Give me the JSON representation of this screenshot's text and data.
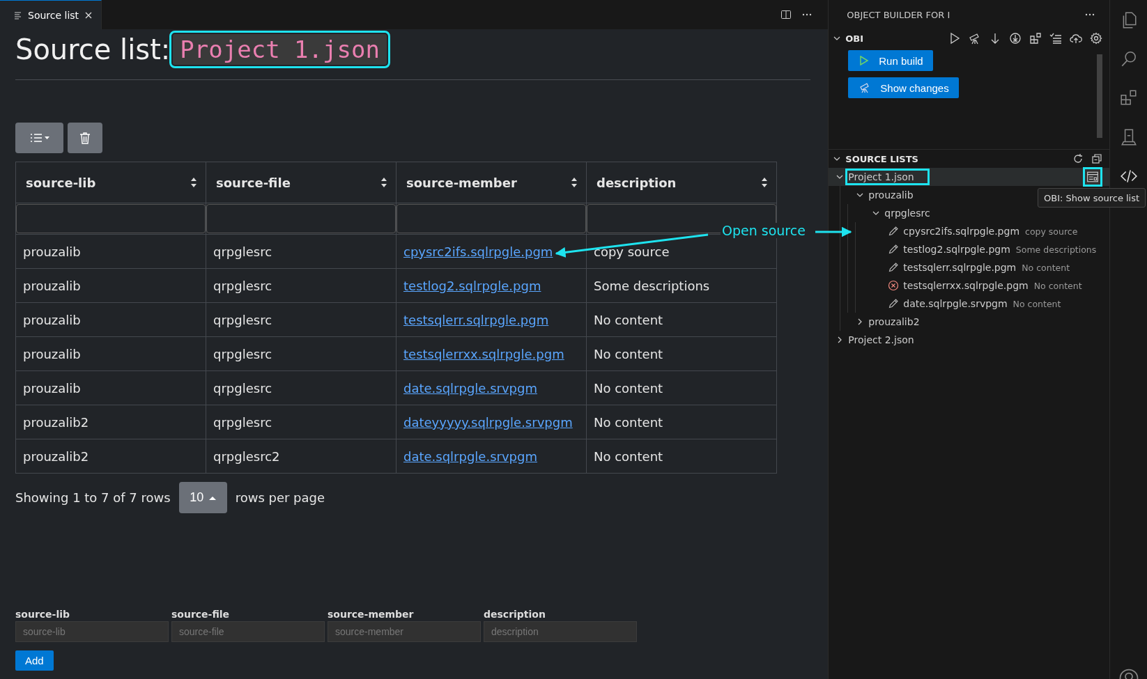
{
  "tab": {
    "label": "Source list",
    "selected": true
  },
  "title": {
    "prefix": "Source list:",
    "name": "Project 1.json"
  },
  "table": {
    "columns": [
      {
        "label": "source-lib"
      },
      {
        "label": "source-file"
      },
      {
        "label": "source-member"
      },
      {
        "label": "description"
      }
    ],
    "rows": [
      {
        "source_lib": "prouzalib",
        "source_file": "qrpglesrc",
        "source_member": "cpysrc2ifs.sqlrpgle.pgm",
        "description": "copy source"
      },
      {
        "source_lib": "prouzalib",
        "source_file": "qrpglesrc",
        "source_member": "testlog2.sqlrpgle.pgm",
        "description": "Some descriptions"
      },
      {
        "source_lib": "prouzalib",
        "source_file": "qrpglesrc",
        "source_member": "testsqlerr.sqlrpgle.pgm",
        "description": "No content"
      },
      {
        "source_lib": "prouzalib",
        "source_file": "qrpglesrc",
        "source_member": "testsqlerrxx.sqlrpgle.pgm",
        "description": "No content"
      },
      {
        "source_lib": "prouzalib",
        "source_file": "qrpglesrc",
        "source_member": "date.sqlrpgle.srvpgm",
        "description": "No content"
      },
      {
        "source_lib": "prouzalib2",
        "source_file": "qrpglesrc",
        "source_member": "dateyyyyy.sqlrpgle.srvpgm",
        "description": "No content"
      },
      {
        "source_lib": "prouzalib2",
        "source_file": "qrpglesrc2",
        "source_member": "date.sqlrpgle.srvpgm",
        "description": "No content"
      }
    ]
  },
  "pagination": {
    "summary": "Showing 1 to 7 of 7 rows",
    "page_size": "10",
    "suffix": "rows per page"
  },
  "form": {
    "fields": [
      {
        "label": "source-lib",
        "placeholder": "source-lib"
      },
      {
        "label": "source-file",
        "placeholder": "source-file"
      },
      {
        "label": "source-member",
        "placeholder": "source-member"
      },
      {
        "label": "description",
        "placeholder": "description"
      }
    ],
    "submit": "Add"
  },
  "sidebar": {
    "title": "OBJECT BUILDER FOR I",
    "obi": {
      "label": "OBI",
      "expanded": true,
      "buttons": [
        {
          "kind": "run",
          "label": "Run build"
        },
        {
          "kind": "changes",
          "label": "Show changes"
        }
      ]
    },
    "source_lists": {
      "label": "SOURCE LISTS",
      "expanded": true,
      "tree": [
        {
          "label": "Project 1.json",
          "kind": "list",
          "expanded": true,
          "selected": true,
          "children": [
            {
              "label": "prouzalib",
              "kind": "folder",
              "expanded": true,
              "children": [
                {
                  "label": "qrpglesrc",
                  "kind": "folder",
                  "expanded": true,
                  "children": [
                    {
                      "label": "cpysrc2ifs.sqlrpgle.pgm",
                      "kind": "member",
                      "description": "copy source"
                    },
                    {
                      "label": "testlog2.sqlrpgle.pgm",
                      "kind": "member",
                      "description": "Some descriptions"
                    },
                    {
                      "label": "testsqlerr.sqlrpgle.pgm",
                      "kind": "member",
                      "description": "No content"
                    },
                    {
                      "label": "testsqlerrxx.sqlrpgle.pgm",
                      "kind": "error",
                      "description": "No content"
                    },
                    {
                      "label": "date.sqlrpgle.srvpgm",
                      "kind": "member",
                      "description": "No content"
                    }
                  ]
                }
              ]
            },
            {
              "label": "prouzalib2",
              "kind": "folder",
              "expanded": false
            }
          ]
        },
        {
          "label": "Project 2.json",
          "kind": "list",
          "expanded": false,
          "selected": false
        }
      ]
    }
  },
  "tooltip": "OBI: Show source list",
  "annotation": {
    "label": "Open source"
  }
}
